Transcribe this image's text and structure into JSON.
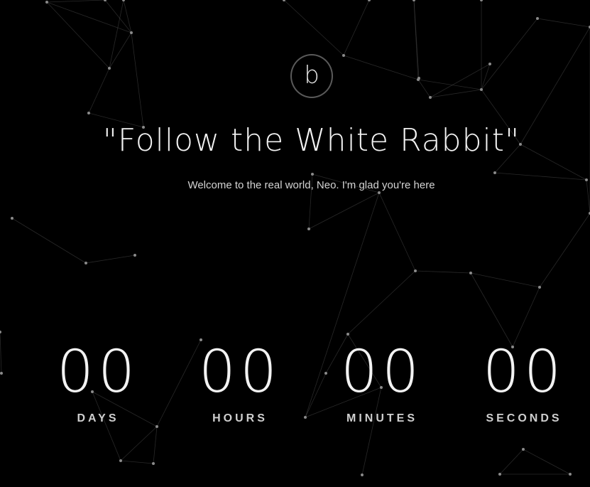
{
  "logo": {
    "letter": "b"
  },
  "hero": {
    "title": "\"Follow the White Rabbit\"",
    "subtitle": "Welcome to the real world, Neo. I'm glad you're here"
  },
  "countdown": [
    {
      "value": "00",
      "label": "DAYS"
    },
    {
      "value": "00",
      "label": "HOURS"
    },
    {
      "value": "00",
      "label": "MINUTES"
    },
    {
      "value": "00",
      "label": "SECONDS"
    }
  ],
  "colors": {
    "background": "#000000",
    "text": "#f2f2f2",
    "network_lines": "#4a4a4a"
  }
}
